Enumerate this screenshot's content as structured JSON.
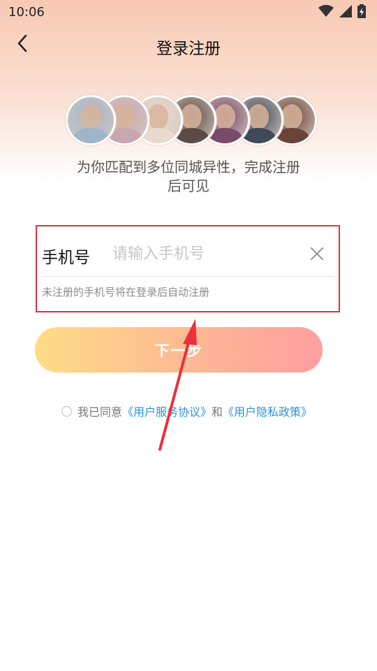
{
  "status_bar": {
    "time": "10:06",
    "icons": [
      "wifi-icon",
      "signal-icon",
      "battery-icon"
    ]
  },
  "header": {
    "back_icon": "chevron-left-icon",
    "title": "登录注册"
  },
  "avatars": {
    "count": 7,
    "colors": [
      "#9fb4c9",
      "#c7a7b2",
      "#e9d9cf",
      "#5b4b45",
      "#7a4a6a",
      "#3f4a58",
      "#6a4438"
    ]
  },
  "tagline": "为你匹配到多位同城异性，完成注册后可见",
  "form": {
    "phone_label": "手机号",
    "phone_value": "",
    "phone_placeholder": "请输入手机号",
    "clear_icon": "close-icon",
    "hint": "未注册的手机号将在登录后自动注册"
  },
  "next_button": {
    "label": "下一步"
  },
  "agreement": {
    "prefix": "我已同意",
    "user_agreement": "《用户服务协议》",
    "conjunction": "和",
    "privacy_policy": "《用户隐私政策》"
  },
  "colors": {
    "highlight_box": "#e0303a",
    "annotation_arrow": "#ee2f3b",
    "link": "#2f8fe0",
    "button_gradient_start": "#fedd86",
    "button_gradient_end": "#fe9ea1"
  }
}
